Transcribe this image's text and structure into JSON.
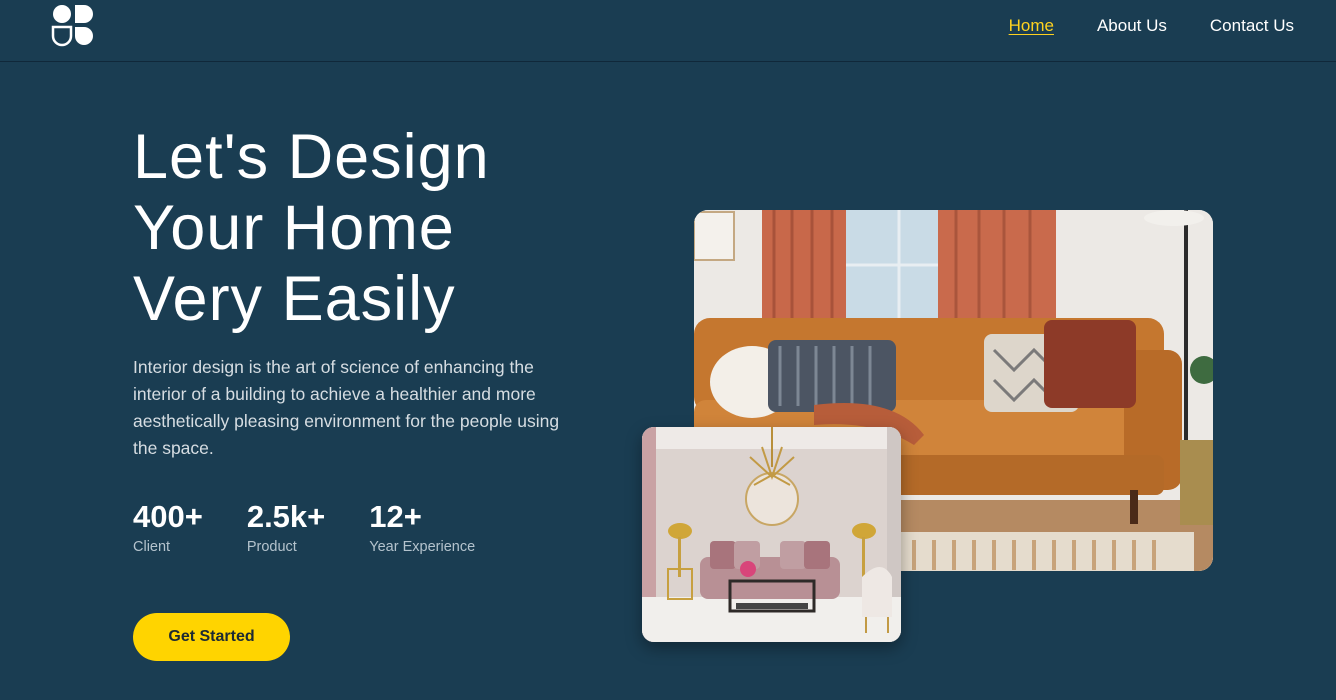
{
  "nav": {
    "logo_icon": "abstract-shapes-logo",
    "items": [
      {
        "label": "Home",
        "active": true
      },
      {
        "label": "About Us",
        "active": false
      },
      {
        "label": "Contact Us",
        "active": false
      }
    ]
  },
  "hero": {
    "title_lines": [
      "Let's Design",
      "Your Home",
      "Very Easily"
    ],
    "description": "Interior design is the art of science of enhancing the interior of a building to achieve a healthier and more aesthetically pleasing environment for the people using the space.",
    "stats": [
      {
        "value": "400+",
        "label": "Client"
      },
      {
        "value": "2.5k+",
        "label": "Product"
      },
      {
        "value": "12+",
        "label": "Year Experience"
      }
    ],
    "cta_label": "Get Started"
  },
  "colors": {
    "background": "#1a3d52",
    "accent": "#ffd400",
    "active_nav": "#ffd21f",
    "text": "#ffffff",
    "muted_text": "#d6dde2"
  }
}
